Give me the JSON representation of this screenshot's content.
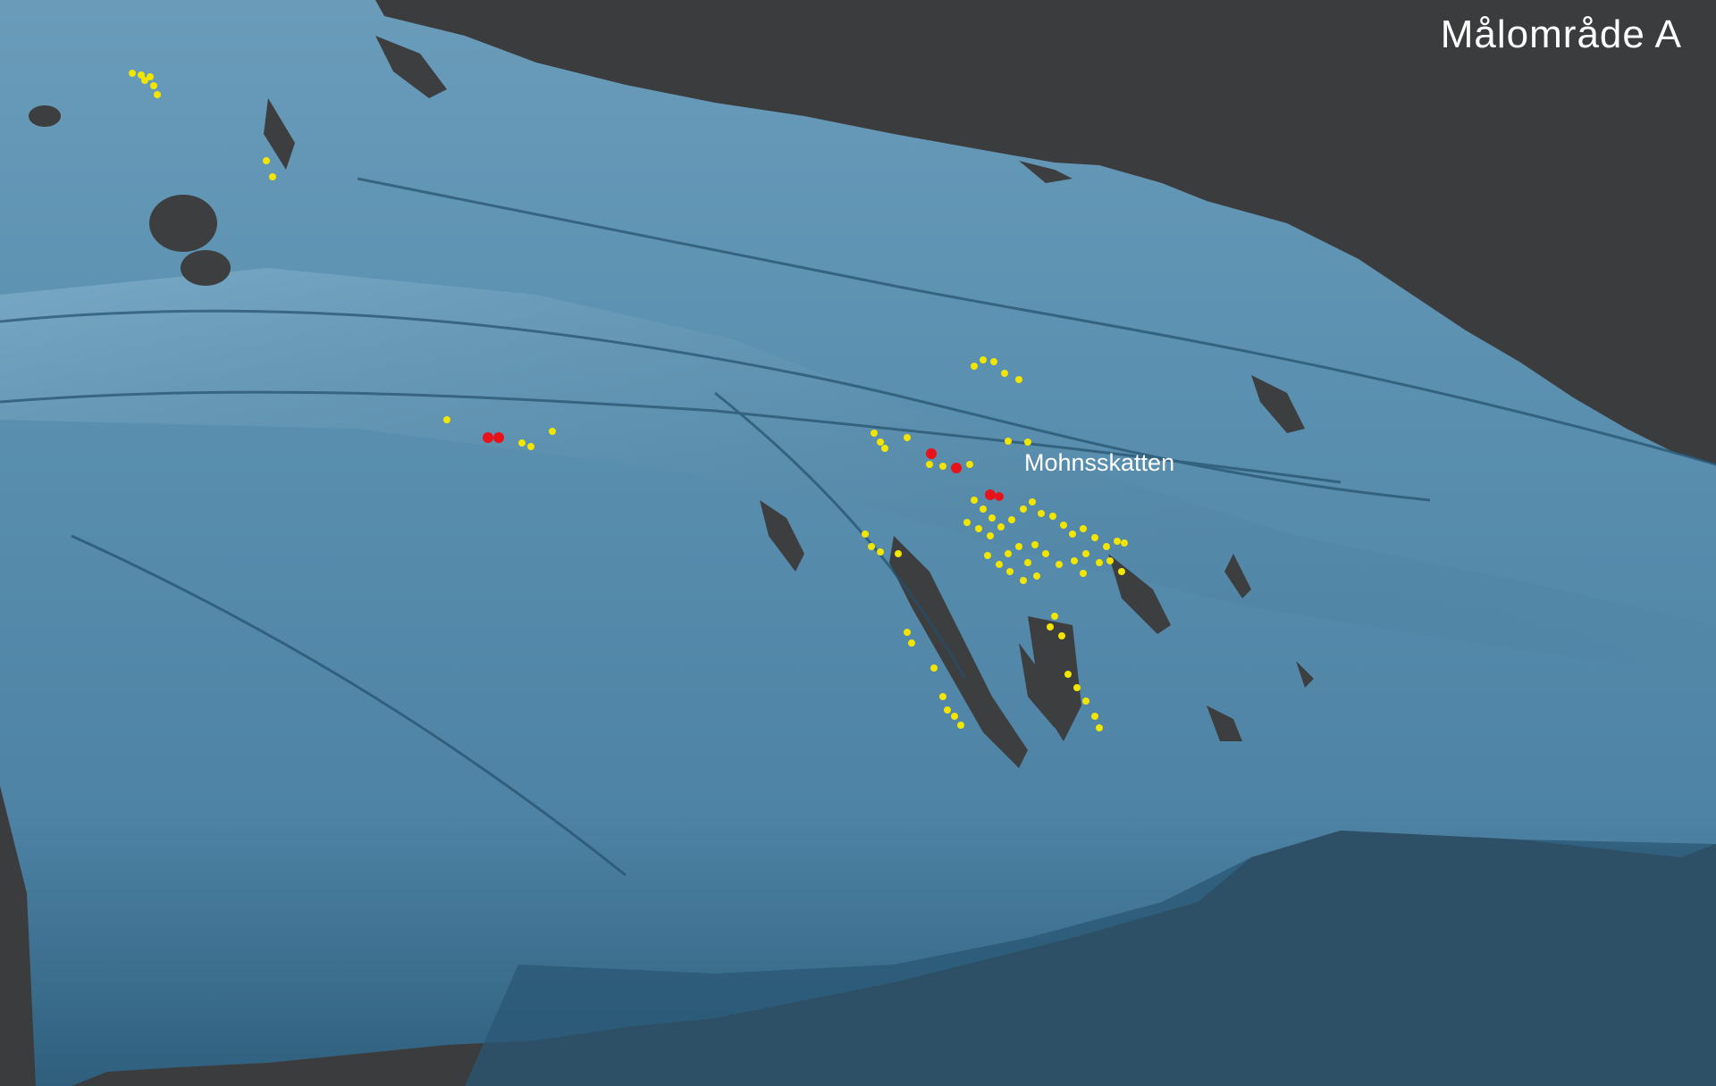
{
  "title": "Målområde  A",
  "labels": {
    "place": "Mohnsskatten"
  },
  "colors": {
    "background": "#3b3c3e",
    "terrain": "#5c8fae",
    "terrain_dark": "#2e5d7a",
    "terrain_light": "#86b5d0",
    "gap": "#3d3e40",
    "marker_primary": "#f2e600",
    "marker_highlight": "#e8121a"
  },
  "legend": {
    "marker_primary": "yellow-point",
    "marker_highlight": "red-point"
  }
}
